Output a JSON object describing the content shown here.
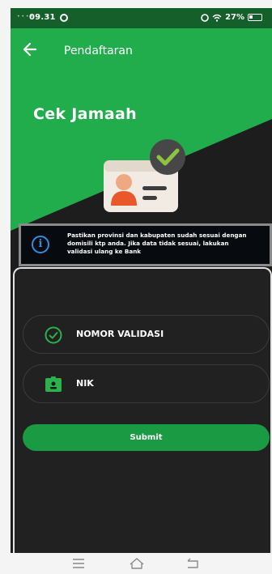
{
  "status_bar": {
    "time": "09.31",
    "battery": "27%"
  },
  "app_bar": {
    "title": "Pendaftaran",
    "back_icon": "arrow-left-icon"
  },
  "hero": {
    "heading": "Cek Jamaah",
    "illustration": "id-card-check-icon"
  },
  "info": {
    "icon": "info-icon",
    "line1": "Pastikan provinsi dan kabupaten sudah sesuai dengan",
    "line2": "domisili ktp anda. Jika data tidak sesuai, lakukan",
    "line3": "validasi ulang ke Bank"
  },
  "form": {
    "validasi_label": "NOMOR VALIDASI",
    "nik_label": "NIK",
    "submit_label": "Submit"
  },
  "colors": {
    "primary_green": "#21ad4c",
    "dark_green": "#155f2b",
    "button_green": "#1a9a43",
    "panel": "#212121",
    "info_blue": "#2f8ddc"
  },
  "system_nav": [
    "menu-icon",
    "home-icon",
    "back-icon"
  ]
}
